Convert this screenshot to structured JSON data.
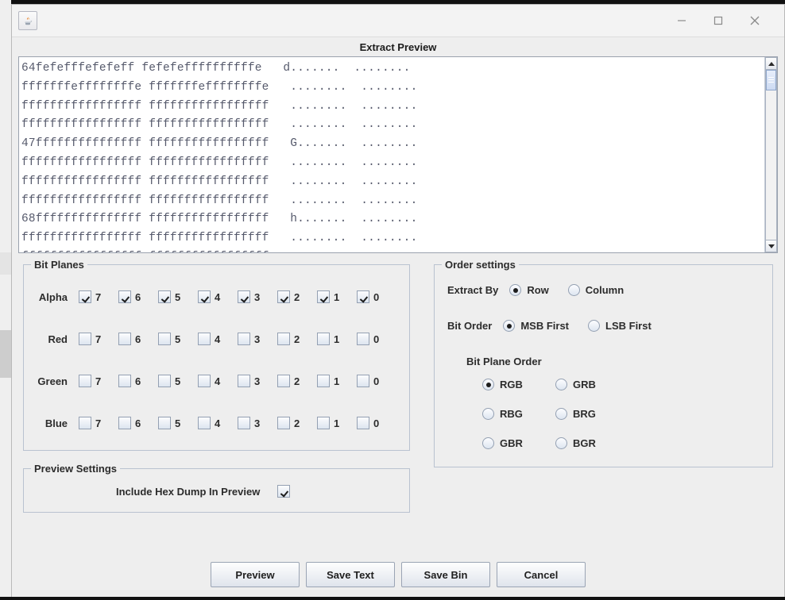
{
  "window": {
    "app_icon": "java-coffee-cup-icon",
    "minimize_label": "minimize-icon",
    "maximize_label": "maximize-icon",
    "close_label": "close-icon"
  },
  "dialog": {
    "title": "Extract Preview"
  },
  "preview": {
    "hexdump_lines": [
      "64fefefffefefeff fefefeffffffffffe   d.......  ........",
      "fffffffeffffffffe fffffffeffffffffe   ........  ........",
      "fffffffffffffffff fffffffffffffffff   ........  ........",
      "fffffffffffffffff fffffffffffffffff   ........  ........",
      "47fffffffffffffff fffffffffffffffff   G.......  ........",
      "fffffffffffffffff fffffffffffffffff   ........  ........",
      "fffffffffffffffff fffffffffffffffff   ........  ........",
      "fffffffffffffffff fffffffffffffffff   ........  ........",
      "68fffffffffffffff fffffffffffffffff   h.......  ........",
      "fffffffffffffffff fffffffffffffffff   ........  ........",
      "fffffffffffffffff fffffffffffffffff   ........  ........"
    ]
  },
  "bit_planes": {
    "title": "Bit Planes",
    "bit_labels": [
      "7",
      "6",
      "5",
      "4",
      "3",
      "2",
      "1",
      "0"
    ],
    "rows": [
      {
        "channel": "Alpha",
        "checked": [
          true,
          true,
          true,
          true,
          true,
          true,
          true,
          true
        ]
      },
      {
        "channel": "Red",
        "checked": [
          false,
          false,
          false,
          false,
          false,
          false,
          false,
          false
        ]
      },
      {
        "channel": "Green",
        "checked": [
          false,
          false,
          false,
          false,
          false,
          false,
          false,
          false
        ]
      },
      {
        "channel": "Blue",
        "checked": [
          false,
          false,
          false,
          false,
          false,
          false,
          false,
          false
        ]
      }
    ]
  },
  "order_settings": {
    "title": "Order settings",
    "extract_by": {
      "label": "Extract By",
      "options": [
        {
          "label": "Row",
          "selected": true
        },
        {
          "label": "Column",
          "selected": false
        }
      ]
    },
    "bit_order": {
      "label": "Bit Order",
      "options": [
        {
          "label": "MSB First",
          "selected": true
        },
        {
          "label": "LSB First",
          "selected": false
        }
      ]
    },
    "bit_plane_order": {
      "label": "Bit Plane Order",
      "options": [
        {
          "label": "RGB",
          "selected": true
        },
        {
          "label": "GRB",
          "selected": false
        },
        {
          "label": "RBG",
          "selected": false
        },
        {
          "label": "BRG",
          "selected": false
        },
        {
          "label": "GBR",
          "selected": false
        },
        {
          "label": "BGR",
          "selected": false
        }
      ]
    }
  },
  "preview_settings": {
    "title": "Preview Settings",
    "include_hex_dump": {
      "label": "Include Hex Dump In Preview",
      "checked": true
    }
  },
  "buttons": [
    {
      "label": "Preview"
    },
    {
      "label": "Save Text"
    },
    {
      "label": "Save Bin"
    },
    {
      "label": "Cancel"
    }
  ],
  "colors": {
    "dialog_bg": "#eeeeee",
    "text_color": "#2c2c2c",
    "hex_text": "#55596b",
    "group_border": "#b9c2d0"
  }
}
